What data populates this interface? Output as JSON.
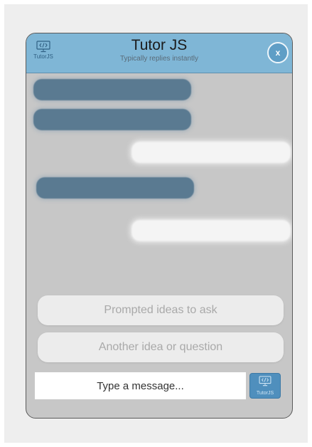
{
  "header": {
    "title": "Tutor JS",
    "subtitle": "Typically replies instantly",
    "brand_label": "TutorJS",
    "close_label": "x"
  },
  "suggestions": [
    "Prompted ideas to ask",
    "Another idea or question"
  ],
  "composer": {
    "placeholder": "Type a message...",
    "send_label": "TutorJS"
  },
  "colors": {
    "header_bg": "#7fb6d6",
    "bot_bubble": "#5a7a91",
    "user_bubble": "#f4f4f4",
    "chat_bg": "#c7c7c7",
    "send_button": "#4f8fbd"
  },
  "icons": {
    "brand": "code-monitor-icon",
    "send": "code-monitor-icon"
  }
}
